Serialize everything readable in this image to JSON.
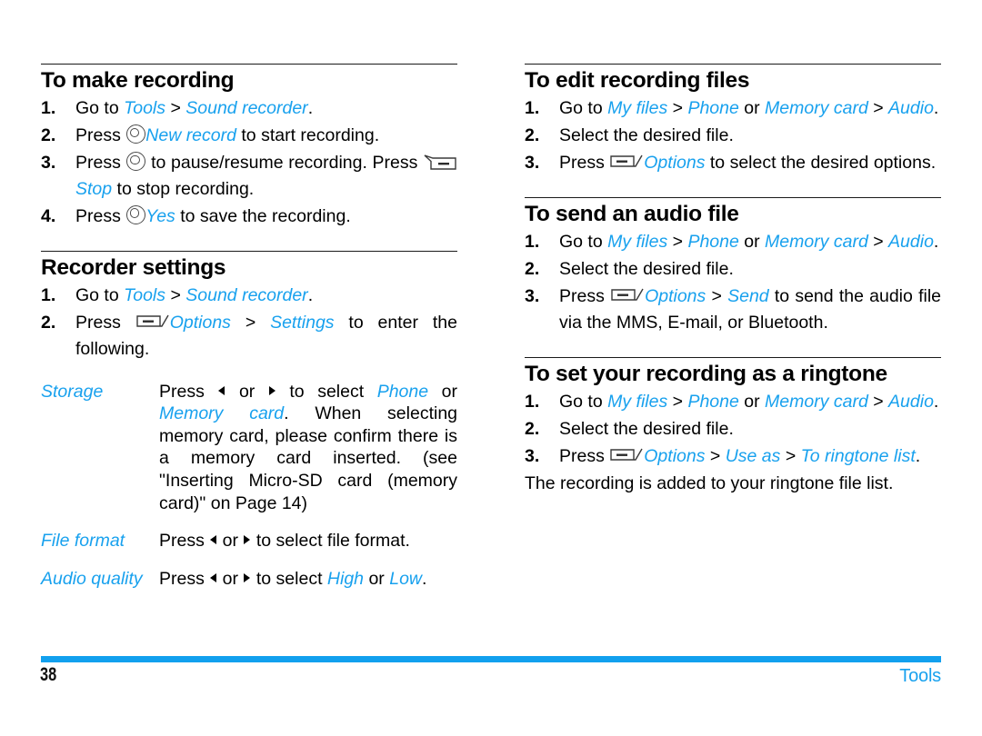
{
  "page": {
    "number": "38",
    "section_label": "Tools",
    "accent_color": "#18A1EE",
    "rule_color": "#1a1a1a"
  },
  "icons": {
    "ok_key": "ok-center-key-icon",
    "left_soft_key": "left-soft-key-icon",
    "right_soft_key": "right-soft-key-icon",
    "left_arrow": "left-arrow-icon",
    "right_arrow": "right-arrow-icon"
  },
  "left_column": {
    "sections": [
      {
        "title": "To make recording",
        "steps": [
          {
            "num": "1.",
            "parts": [
              {
                "t": "Go to ",
                "s": "plain"
              },
              {
                "t": "Tools",
                "s": "menu"
              },
              {
                "t": " > ",
                "s": "plain"
              },
              {
                "t": "Sound recorder",
                "s": "menu"
              },
              {
                "t": ".",
                "s": "plain"
              }
            ]
          },
          {
            "num": "2.",
            "parts": [
              {
                "t": "Press ",
                "s": "plain"
              },
              {
                "t": "",
                "s": "icon-ok"
              },
              {
                "t": "New record",
                "s": "menu"
              },
              {
                "t": " to start recording.",
                "s": "plain"
              }
            ]
          },
          {
            "num": "3.",
            "parts": [
              {
                "t": "Press ",
                "s": "plain"
              },
              {
                "t": "",
                "s": "icon-ok"
              },
              {
                "t": " to pause/resume recording. Press ",
                "s": "plain"
              },
              {
                "t": "",
                "s": "icon-soft-left"
              },
              {
                "t": "Stop",
                "s": "menu"
              },
              {
                "t": " to stop recording.",
                "s": "plain"
              }
            ]
          },
          {
            "num": "4.",
            "parts": [
              {
                "t": "Press ",
                "s": "plain"
              },
              {
                "t": "",
                "s": "icon-ok"
              },
              {
                "t": "Yes",
                "s": "menu"
              },
              {
                "t": " to save the recording.",
                "s": "plain"
              }
            ]
          }
        ]
      },
      {
        "title": "Recorder settings",
        "steps": [
          {
            "num": "1.",
            "parts": [
              {
                "t": "Go to ",
                "s": "plain"
              },
              {
                "t": "Tools",
                "s": "menu"
              },
              {
                "t": " > ",
                "s": "plain"
              },
              {
                "t": "Sound recorder",
                "s": "menu"
              },
              {
                "t": ".",
                "s": "plain"
              }
            ]
          },
          {
            "num": "2.",
            "parts": [
              {
                "t": "Press ",
                "s": "plain"
              },
              {
                "t": "",
                "s": "icon-soft-right"
              },
              {
                "t": "Options",
                "s": "menu"
              },
              {
                "t": " > ",
                "s": "plain"
              },
              {
                "t": "Settings",
                "s": "menu"
              },
              {
                "t": " to enter the following.",
                "s": "plain"
              }
            ]
          }
        ],
        "definitions": [
          {
            "term": "Storage",
            "parts": [
              {
                "t": "Press ",
                "s": "plain"
              },
              {
                "t": "",
                "s": "icon-arrow-left"
              },
              {
                "t": " or ",
                "s": "plain"
              },
              {
                "t": "",
                "s": "icon-arrow-right"
              },
              {
                "t": " to select ",
                "s": "plain"
              },
              {
                "t": "Phone",
                "s": "menu"
              },
              {
                "t": " or ",
                "s": "plain"
              },
              {
                "t": "Memory card",
                "s": "menu"
              },
              {
                "t": ". When selecting memory card, please confirm there is a memory card inserted. (see \"Inserting Micro-SD card (memory card)\" on Page 14)",
                "s": "plain"
              }
            ]
          },
          {
            "term": "File format",
            "parts": [
              {
                "t": "Press ",
                "s": "plain"
              },
              {
                "t": "",
                "s": "icon-arrow-left"
              },
              {
                "t": " or ",
                "s": "plain"
              },
              {
                "t": "",
                "s": "icon-arrow-right"
              },
              {
                "t": " to select file format.",
                "s": "plain"
              }
            ]
          },
          {
            "term": "Audio quality",
            "parts": [
              {
                "t": "Press ",
                "s": "plain"
              },
              {
                "t": "",
                "s": "icon-arrow-left"
              },
              {
                "t": " or ",
                "s": "plain"
              },
              {
                "t": "",
                "s": "icon-arrow-right"
              },
              {
                "t": " to select ",
                "s": "plain"
              },
              {
                "t": "High",
                "s": "menu"
              },
              {
                "t": " or ",
                "s": "plain"
              },
              {
                "t": "Low",
                "s": "menu"
              },
              {
                "t": ".",
                "s": "plain"
              }
            ]
          }
        ]
      }
    ]
  },
  "right_column": {
    "sections": [
      {
        "title": "To edit recording files",
        "steps": [
          {
            "num": "1.",
            "parts": [
              {
                "t": "Go to ",
                "s": "plain"
              },
              {
                "t": "My files",
                "s": "menu"
              },
              {
                "t": " > ",
                "s": "plain"
              },
              {
                "t": "Phone",
                "s": "menu"
              },
              {
                "t": " or ",
                "s": "plain"
              },
              {
                "t": "Memory card",
                "s": "menu"
              },
              {
                "t": " > ",
                "s": "plain"
              },
              {
                "t": "Audio",
                "s": "menu"
              },
              {
                "t": ".",
                "s": "plain"
              }
            ]
          },
          {
            "num": "2.",
            "parts": [
              {
                "t": "Select the desired file.",
                "s": "plain"
              }
            ]
          },
          {
            "num": "3.",
            "parts": [
              {
                "t": "Press ",
                "s": "plain"
              },
              {
                "t": "",
                "s": "icon-soft-right"
              },
              {
                "t": "Options",
                "s": "menu"
              },
              {
                "t": " to select the desired options.",
                "s": "plain"
              }
            ]
          }
        ]
      },
      {
        "title": "To send an audio file",
        "steps": [
          {
            "num": "1.",
            "parts": [
              {
                "t": "Go to ",
                "s": "plain"
              },
              {
                "t": "My files",
                "s": "menu"
              },
              {
                "t": " > ",
                "s": "plain"
              },
              {
                "t": "Phone",
                "s": "menu"
              },
              {
                "t": " or ",
                "s": "plain"
              },
              {
                "t": "Memory card",
                "s": "menu"
              },
              {
                "t": " > ",
                "s": "plain"
              },
              {
                "t": "Audio",
                "s": "menu"
              },
              {
                "t": ".",
                "s": "plain"
              }
            ]
          },
          {
            "num": "2.",
            "parts": [
              {
                "t": "Select the desired file.",
                "s": "plain"
              }
            ]
          },
          {
            "num": "3.",
            "parts": [
              {
                "t": "Press ",
                "s": "plain"
              },
              {
                "t": "",
                "s": "icon-soft-right"
              },
              {
                "t": "Options",
                "s": "menu"
              },
              {
                "t": " > ",
                "s": "plain"
              },
              {
                "t": "Send",
                "s": "menu"
              },
              {
                "t": " to send the audio file via the MMS, E-mail, or Bluetooth.",
                "s": "plain"
              }
            ]
          }
        ]
      },
      {
        "title": "To set your recording as a ringtone",
        "steps": [
          {
            "num": "1.",
            "parts": [
              {
                "t": "Go to ",
                "s": "plain"
              },
              {
                "t": "My files",
                "s": "menu"
              },
              {
                "t": " > ",
                "s": "plain"
              },
              {
                "t": "Phone",
                "s": "menu"
              },
              {
                "t": " or ",
                "s": "plain"
              },
              {
                "t": "Memory card",
                "s": "menu"
              },
              {
                "t": " > ",
                "s": "plain"
              },
              {
                "t": "Audio",
                "s": "menu"
              },
              {
                "t": ".",
                "s": "plain"
              }
            ]
          },
          {
            "num": "2.",
            "parts": [
              {
                "t": "Select the desired file.",
                "s": "plain"
              }
            ]
          },
          {
            "num": "3.",
            "parts": [
              {
                "t": "Press ",
                "s": "plain"
              },
              {
                "t": "",
                "s": "icon-soft-right"
              },
              {
                "t": "Options",
                "s": "menu"
              },
              {
                "t": " > ",
                "s": "plain"
              },
              {
                "t": "Use as",
                "s": "menu"
              },
              {
                "t": " > ",
                "s": "plain"
              },
              {
                "t": "To ringtone list",
                "s": "menu"
              },
              {
                "t": ".",
                "s": "plain"
              }
            ]
          }
        ],
        "trailing_text": "The recording is added to your ringtone file list."
      }
    ]
  }
}
